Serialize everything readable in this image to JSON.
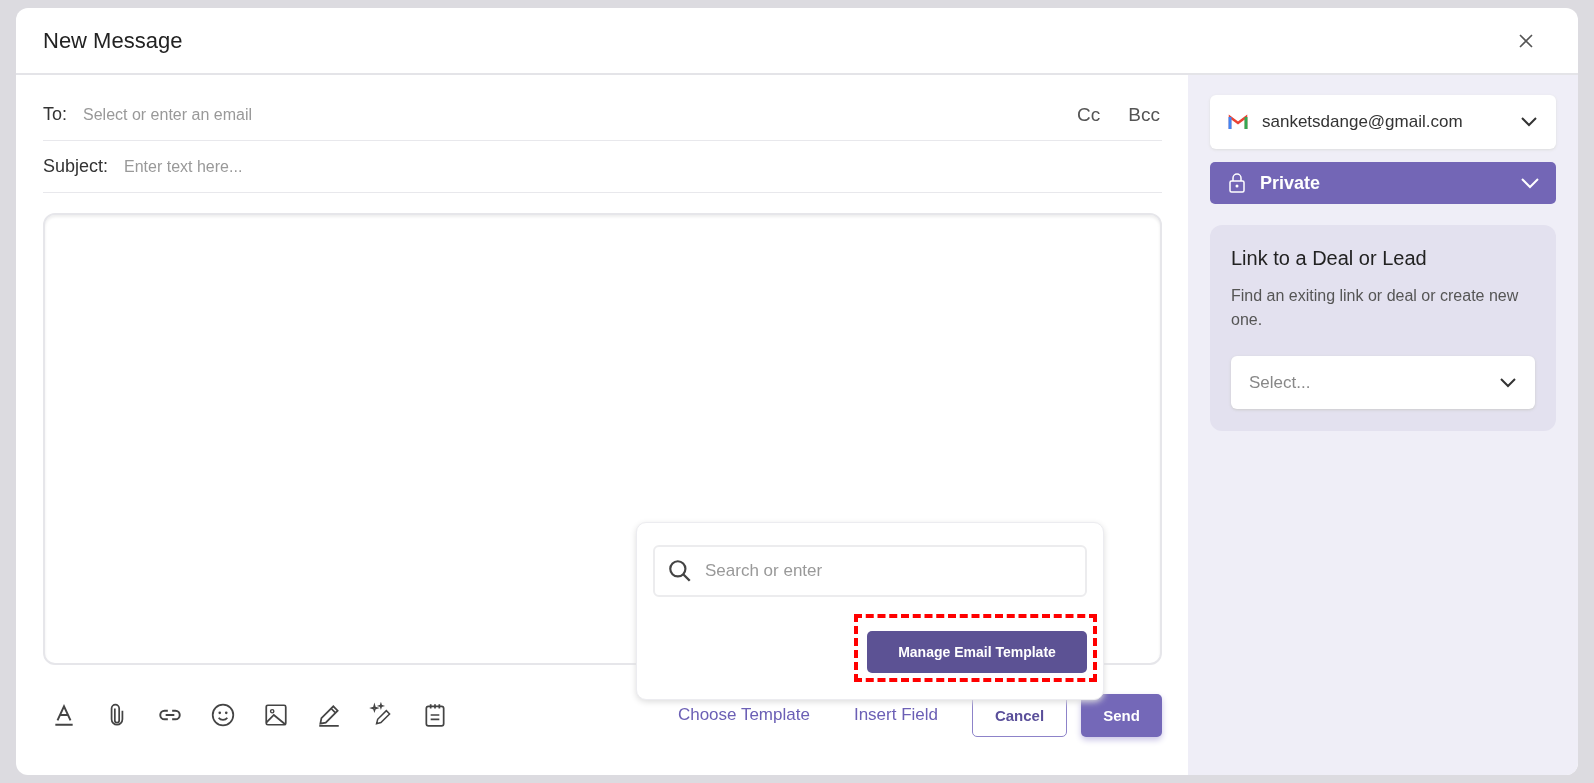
{
  "window": {
    "title": "New Message"
  },
  "compose": {
    "to_label": "To:",
    "to_placeholder": "Select or enter an email",
    "cc": "Cc",
    "bcc": "Bcc",
    "subject_label": "Subject:",
    "subject_placeholder": "Enter text here..."
  },
  "template_popup": {
    "search_placeholder": "Search or enter",
    "manage_button": "Manage Email Template",
    "highlighted": true
  },
  "footer": {
    "choose_template": "Choose Template",
    "insert_field": "Insert Field",
    "cancel": "Cancel",
    "send": "Send"
  },
  "sidebar": {
    "sender": "sanketsdange@gmail.com",
    "visibility": "Private",
    "link_card": {
      "title": "Link to a Deal or Lead",
      "description": "Find an exiting link or deal or create new one.",
      "select_placeholder": "Select..."
    }
  }
}
